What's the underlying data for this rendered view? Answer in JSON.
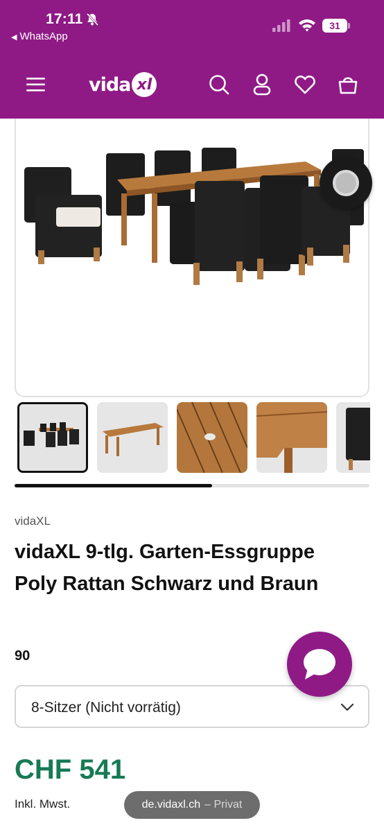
{
  "status_bar": {
    "time": "17:11",
    "back_app": "WhatsApp",
    "battery": "31"
  },
  "header": {
    "logo_text": "vida",
    "logo_badge": "xl",
    "brand_color": "#8f1a86",
    "icons": [
      "menu-icon",
      "search-icon",
      "user-icon",
      "heart-icon",
      "cart-icon"
    ]
  },
  "gallery": {
    "thumbnails": [
      "set-overview",
      "table",
      "tabletop-detail",
      "corner-detail",
      "chair"
    ],
    "active_index": 0,
    "scroll_progress": 0.55
  },
  "product": {
    "brand": "vidaXL",
    "title_line1": "vidaXL 9-tlg. Garten-Essgruppe",
    "title_line2": "Poly Rattan Schwarz und Braun",
    "variant_label": "90",
    "selected_option": "8-Sitzer (Nicht vorrätig)",
    "price": "CHF 541",
    "price_color": "#167a54",
    "vat_note": "Inkl. Mwst."
  },
  "browser": {
    "domain": "de.vidaxl.ch",
    "mode": "– Privat"
  }
}
